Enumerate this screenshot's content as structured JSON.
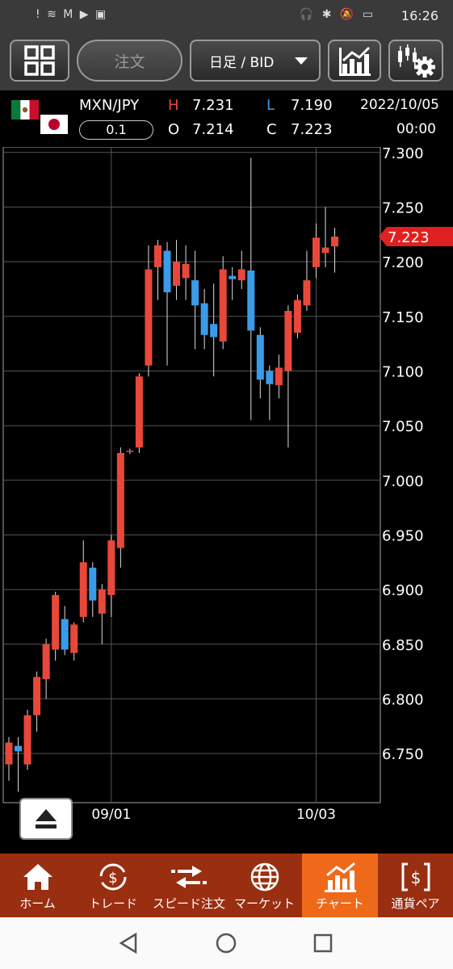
{
  "status": {
    "left_icons": "! ≋ M ▶ ▣",
    "right_icons": "🎧 ✱ 🔕 ▭",
    "time": "16:26"
  },
  "toolbar": {
    "order_label": "注文",
    "period_label": "日足 / BID"
  },
  "info": {
    "pair": "MXN/JPY",
    "lot": "0.1",
    "high_label": "H",
    "high": "7.231",
    "low_label": "L",
    "low": "7.190",
    "open_label": "O",
    "open": "7.214",
    "close_label": "C",
    "close": "7.223",
    "date": "2022/10/05",
    "time": "00:00"
  },
  "colors": {
    "up": "#e8483a",
    "down": "#3a9be8",
    "tab_bar": "#9a2e10",
    "tab_active": "#ee6a1a"
  },
  "chart_data": {
    "type": "candlestick",
    "y_ticks": [
      "7.300",
      "7.250",
      "7.200",
      "7.150",
      "7.100",
      "7.050",
      "7.000",
      "6.950",
      "6.900",
      "6.850",
      "6.800",
      "6.750"
    ],
    "ylim": [
      6.705,
      7.305
    ],
    "x_labels": [
      {
        "index": 11,
        "label": "09/01"
      },
      {
        "index": 33,
        "label": "10/03"
      }
    ],
    "last_price": "7.223",
    "candles": [
      {
        "o": 6.74,
        "h": 6.765,
        "l": 6.725,
        "c": 6.76
      },
      {
        "o": 6.757,
        "h": 6.765,
        "l": 6.715,
        "c": 6.752
      },
      {
        "o": 6.74,
        "h": 6.79,
        "l": 6.735,
        "c": 6.785
      },
      {
        "o": 6.785,
        "h": 6.825,
        "l": 6.77,
        "c": 6.82
      },
      {
        "o": 6.818,
        "h": 6.855,
        "l": 6.8,
        "c": 6.85
      },
      {
        "o": 6.845,
        "h": 6.898,
        "l": 6.835,
        "c": 6.895
      },
      {
        "o": 6.873,
        "h": 6.885,
        "l": 6.84,
        "c": 6.845
      },
      {
        "o": 6.842,
        "h": 6.87,
        "l": 6.835,
        "c": 6.868
      },
      {
        "o": 6.875,
        "h": 6.945,
        "l": 6.87,
        "c": 6.925
      },
      {
        "o": 6.92,
        "h": 6.925,
        "l": 6.875,
        "c": 6.89
      },
      {
        "o": 6.878,
        "h": 6.905,
        "l": 6.85,
        "c": 6.9
      },
      {
        "o": 6.895,
        "h": 6.95,
        "l": 6.875,
        "c": 6.945
      },
      {
        "o": 6.938,
        "h": 7.03,
        "l": 6.92,
        "c": 7.025
      },
      {
        "o": 7.026,
        "h": 7.029,
        "l": 7.024,
        "c": 7.027
      },
      {
        "o": 7.03,
        "h": 7.098,
        "l": 7.025,
        "c": 7.095
      },
      {
        "o": 7.105,
        "h": 7.215,
        "l": 7.095,
        "c": 7.193
      },
      {
        "o": 7.195,
        "h": 7.22,
        "l": 7.165,
        "c": 7.215
      },
      {
        "o": 7.21,
        "h": 7.218,
        "l": 7.105,
        "c": 7.172
      },
      {
        "o": 7.178,
        "h": 7.22,
        "l": 7.165,
        "c": 7.2
      },
      {
        "o": 7.185,
        "h": 7.215,
        "l": 7.165,
        "c": 7.198
      },
      {
        "o": 7.183,
        "h": 7.21,
        "l": 7.12,
        "c": 7.16
      },
      {
        "o": 7.162,
        "h": 7.175,
        "l": 7.12,
        "c": 7.133
      },
      {
        "o": 7.143,
        "h": 7.18,
        "l": 7.095,
        "c": 7.131
      },
      {
        "o": 7.127,
        "h": 7.205,
        "l": 7.12,
        "c": 7.193
      },
      {
        "o": 7.187,
        "h": 7.195,
        "l": 7.165,
        "c": 7.184
      },
      {
        "o": 7.183,
        "h": 7.21,
        "l": 7.175,
        "c": 7.193
      },
      {
        "o": 7.192,
        "h": 7.295,
        "l": 7.055,
        "c": 7.137
      },
      {
        "o": 7.133,
        "h": 7.14,
        "l": 7.075,
        "c": 7.092
      },
      {
        "o": 7.1,
        "h": 7.105,
        "l": 7.055,
        "c": 7.088
      },
      {
        "o": 7.087,
        "h": 7.115,
        "l": 7.075,
        "c": 7.103
      },
      {
        "o": 7.1,
        "h": 7.16,
        "l": 7.03,
        "c": 7.155
      },
      {
        "o": 7.135,
        "h": 7.17,
        "l": 7.13,
        "c": 7.165
      },
      {
        "o": 7.16,
        "h": 7.21,
        "l": 7.155,
        "c": 7.183
      },
      {
        "o": 7.195,
        "h": 7.235,
        "l": 7.185,
        "c": 7.222
      },
      {
        "o": 7.208,
        "h": 7.25,
        "l": 7.195,
        "c": 7.213
      },
      {
        "o": 7.214,
        "h": 7.231,
        "l": 7.19,
        "c": 7.223
      }
    ]
  },
  "tabs": [
    {
      "label": "ホーム",
      "icon": "home-icon"
    },
    {
      "label": "トレード",
      "icon": "trade-icon"
    },
    {
      "label": "スピード注文",
      "icon": "speed-order-icon"
    },
    {
      "label": "マーケット",
      "icon": "market-icon"
    },
    {
      "label": "チャート",
      "icon": "chart-icon",
      "active": true
    },
    {
      "label": "通貨ペア",
      "icon": "currency-pair-icon"
    }
  ]
}
